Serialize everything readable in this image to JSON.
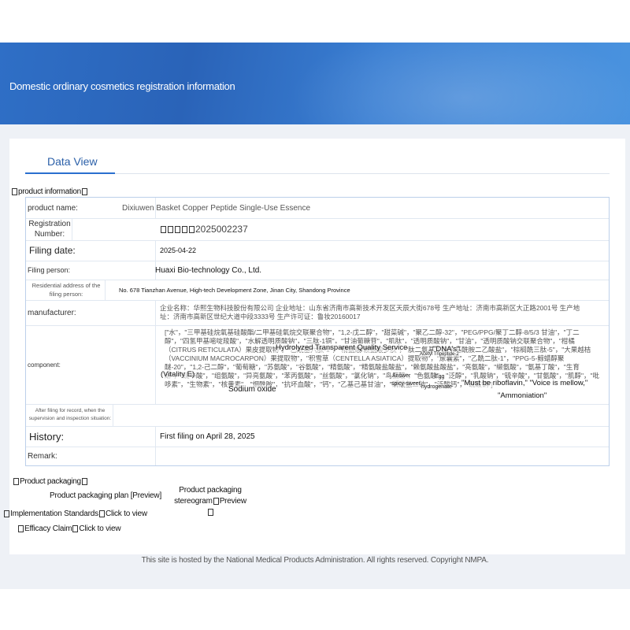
{
  "banner": {
    "title": "Domestic ordinary cosmetics registration information"
  },
  "tabs": {
    "data_view": "Data View"
  },
  "sections": {
    "product_information": "product information",
    "product_packaging": "Product packaging"
  },
  "fields": {
    "product_name": {
      "label": "product name:",
      "value": "Dixiuwen Basket Copper Peptide Single-Use Essence"
    },
    "registration_number": {
      "label": "Registration Number:",
      "value": "2025002237"
    },
    "filing_date": {
      "label": "Filing date:",
      "value": "2025-04-22"
    },
    "filing_person": {
      "label": "Filing person:",
      "value": "Huaxi Bio-technology Co., Ltd."
    },
    "residential_address": {
      "label": "Residential address of the filing person:",
      "value": "No. 678 Tianzhan Avenue, High-tech Development Zone, Jinan City, Shandong Province"
    },
    "manufacturer": {
      "label": "manufacturer:",
      "value": "企业名称：华熙生物科技股份有限公司 企业地址：山东省济南市高新技术开发区天辰大街678号 生产地址：济南市高新区大正路2001号 生产地址：济南市高新区世纪大道中段3333号 生产许可证：鲁妆20160017"
    },
    "component": {
      "label": "component:",
      "value": "[\"水\"，\"三甲基硅烷氧基硅酸酯/二甲基硅氧烷交联聚合物\"，\"1,2-戊二醇\"，\"甜菜碱\"，\"聚乙二醇-32\"，\"PEG/PPG/聚丁二醇-8/5/3 甘油\"，\"丁二醇\"，\"四氢甲基嘧啶羧酸\"，\"水解透明质酸钠\"，\"三肽-1铜\"，\"甘油葡糖苷\"，\"肌肽\"，\"透明质酸钠\"，\"甘油\"，\"透明质酸钠交联聚合物\"，\"柑橘（CITRUS RETICULATA）果皮提取物\"，\"乙酰基六肽-1\"，\"精氨酸/赖氨酸多肽\"，\"肽二氨基丁酰苄基酰胺二乙酸盐\"，\"棕榈酰三肽-5\"，\"大果越桔（VACCINIUM MACROCARPON）果提取物\"，\"积雪草（CENTELLA ASIATICA）提取物\"，\"尿囊素\"，\"乙酰二肽-1\"，\"PPG-5-鲸蜡醇聚醚-20\"，\"1,2-己二醇\"，\"葡萄糖\"，\"苏氨酸\"，\"谷氨酸\"，\"精氨酸\"，\"精氨酸盐酸盐\"，\"赖氨酸盐酸盐\"，\"亮氨酸\"，\"缬氨酸\"，\"氨基丁酸\"，\"生育酚\"，\"硫辛酸\"，\"组氨酸\"，\"异亮氨酸\"，\"苯丙氨酸\"，\"丝氨酸\"，\"氯化钠\"，\"鸟氨酸\"，\"色氨酸\"，\"泛醇\"，\"乳酸钠\"，\"硫辛酸\"，\"甘氨酸\"，\"肌醇\"，\"吡哆素\"，\"生物素\"，\"核黄素\"，\"烟酰胺\"，\"抗坏血酸\"，\"钙\"，\"乙基己基甘油\"，\"磷酸氢二钠\"，\"泛酸钙\"，\"硫酸铜\"]",
      "overlays": {
        "hydrolyzed": "Hydrolyzed Transparent Quality Service",
        "dnas": "\"DNA's\"",
        "acetyl": "Acetyl Tripeptide-2",
        "vitality": "(Vitality E)",
        "answer": "Answer",
        "egg": "Egg",
        "riboflavin": "\"Must be riboflavin,\" \"Voice is mellow,\"",
        "sodium": "Sodium oxide",
        "spicy": "spicy-sweet",
        "hydrogenate": "hydrogenate",
        "ammoniation": "\"Ammoniation\""
      }
    },
    "after_filing": {
      "label": "After filing for record, when the supervision and inspection situation:",
      "value": ""
    },
    "history": {
      "label": "History:",
      "value": "First filing on April 28, 2025"
    },
    "remark": {
      "label": "Remark:",
      "value": ""
    }
  },
  "packaging": {
    "plan": "Product packaging plan [Preview]",
    "stereogram": "Product packaging stereogram",
    "stereogram_preview": "Preview",
    "implementation": "Implementation Standards",
    "implementation_link": "Click to view",
    "efficacy": "Efficacy Claim",
    "efficacy_link": "Click to view"
  },
  "footer": {
    "text": "This site is hosted by the National Medical Products Administration. All rights reserved. Copyright NMPA."
  }
}
